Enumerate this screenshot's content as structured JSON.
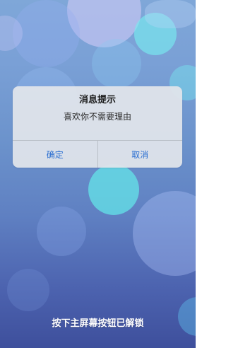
{
  "colors": {
    "accent_blue": "#2c6fd1",
    "dialog_background": "#dfe4ea"
  },
  "dialog": {
    "title": "消息提示",
    "message": "喜欢你不需要理由",
    "confirm_label": "确定",
    "cancel_label": "取消"
  },
  "lockscreen": {
    "unlock_hint": "按下主屏幕按钮已解锁"
  }
}
